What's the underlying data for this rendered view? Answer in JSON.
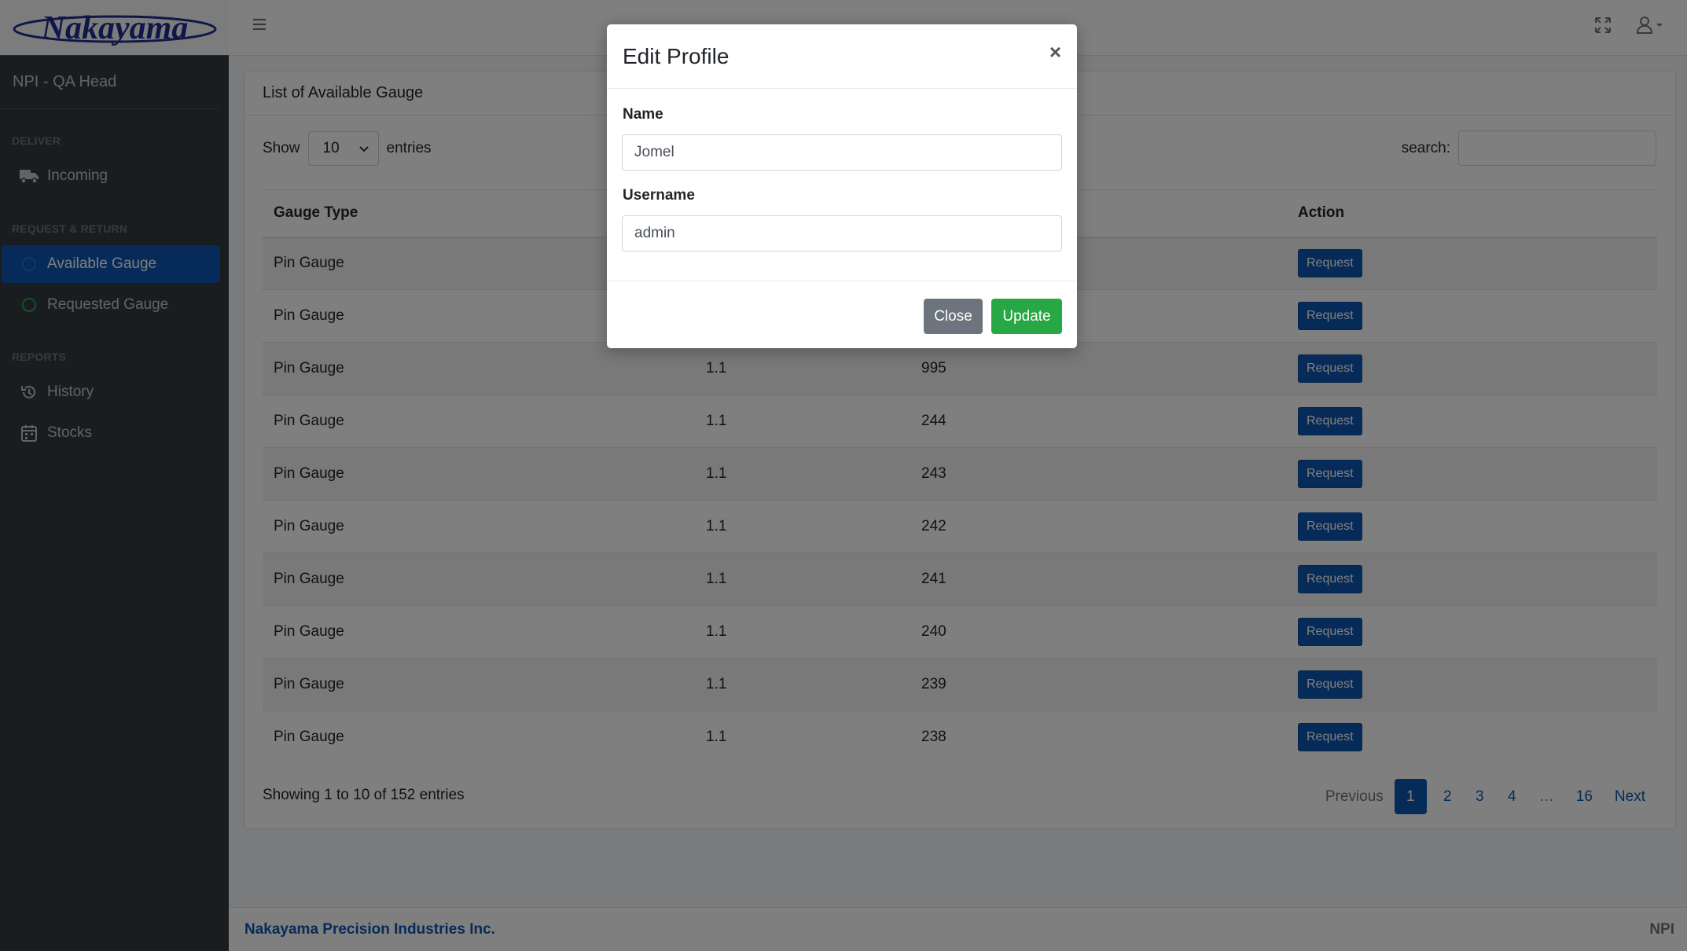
{
  "brand": {
    "logo_text": "Nakayama"
  },
  "sidebar": {
    "user": "NPI - QA Head",
    "sections": [
      {
        "header": "DELIVER"
      },
      {
        "header": "REQUEST & RETURN"
      },
      {
        "header": "REPORTS"
      }
    ],
    "items": [
      {
        "label": "Incoming",
        "icon": "truck-icon"
      },
      {
        "label": "Available Gauge",
        "icon": "circle-icon",
        "active": true
      },
      {
        "label": "Requested Gauge",
        "icon": "circle-icon"
      },
      {
        "label": "History",
        "icon": "history-icon"
      },
      {
        "label": "Stocks",
        "icon": "calendar-icon"
      }
    ]
  },
  "card": {
    "title": "List of Available Gauge",
    "show_label": "Show",
    "entries_value": "10",
    "entries_label": "entries",
    "search_label": "search:",
    "columns": [
      "Gauge Type",
      "",
      "",
      "Action"
    ],
    "rows": [
      {
        "type": "Pin Gauge",
        "size": "",
        "no": "",
        "action": "Request"
      },
      {
        "type": "Pin Gauge",
        "size": "",
        "no": "",
        "action": "Request"
      },
      {
        "type": "Pin Gauge",
        "size": "1.1",
        "no": "995",
        "action": "Request"
      },
      {
        "type": "Pin Gauge",
        "size": "1.1",
        "no": "244",
        "action": "Request"
      },
      {
        "type": "Pin Gauge",
        "size": "1.1",
        "no": "243",
        "action": "Request"
      },
      {
        "type": "Pin Gauge",
        "size": "1.1",
        "no": "242",
        "action": "Request"
      },
      {
        "type": "Pin Gauge",
        "size": "1.1",
        "no": "241",
        "action": "Request"
      },
      {
        "type": "Pin Gauge",
        "size": "1.1",
        "no": "240",
        "action": "Request"
      },
      {
        "type": "Pin Gauge",
        "size": "1.1",
        "no": "239",
        "action": "Request"
      },
      {
        "type": "Pin Gauge",
        "size": "1.1",
        "no": "238",
        "action": "Request"
      }
    ],
    "info": "Showing 1 to 10 of 152 entries",
    "pagination": [
      "Previous",
      "1",
      "2",
      "3",
      "4",
      "…",
      "16",
      "Next"
    ]
  },
  "footer": {
    "company": "Nakayama Precision Industries Inc.",
    "abbr": "NPI"
  },
  "modal": {
    "title": "Edit Profile",
    "close_symbol": "×",
    "name_label": "Name",
    "name_value": "Jomel",
    "username_label": "Username",
    "username_value": "admin",
    "close_button": "Close",
    "update_button": "Update"
  },
  "colors": {
    "primary": "#0d56b3",
    "success": "#28a745",
    "secondary": "#6c757d",
    "sidebar": "#343a40"
  }
}
